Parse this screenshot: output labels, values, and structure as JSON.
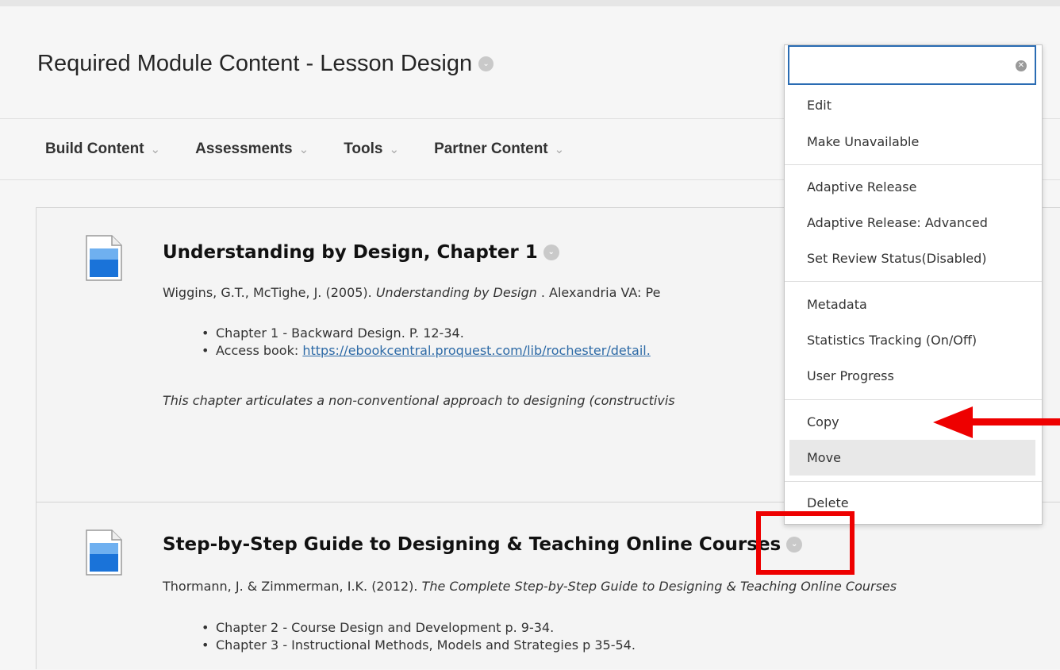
{
  "page": {
    "title": "Required Module Content - Lesson Design",
    "title_menu_icon": "chevron-down-icon"
  },
  "toolbar": {
    "items": [
      {
        "label": "Build Content"
      },
      {
        "label": "Assessments"
      },
      {
        "label": "Tools"
      },
      {
        "label": "Partner Content"
      }
    ]
  },
  "items": [
    {
      "icon": "document-icon",
      "title": "Understanding by Design, Chapter 1",
      "ref_authors": "Wiggins, G.T., McTighe, J. (2005). ",
      "ref_book": "Understanding by Design",
      "ref_rest": " . Alexandria VA: Pe",
      "bullets": [
        "Chapter 1 - Backward Design. P. 12-34."
      ],
      "access_label": "Access book: ",
      "access_link": "https://ebookcentral.proquest.com/lib/rochester/detail.",
      "description": "This chapter articulates a non-conventional approach to designing (constructivis"
    },
    {
      "icon": "document-icon",
      "title": "Step-by-Step Guide to Designing & Teaching Online Courses",
      "ref_authors": "Thormann, J. & Zimmerman, I.K. (2012).  ",
      "ref_book": "The Complete Step-by-Step Guide to Designing & Teaching Online Courses",
      "bullets": [
        "Chapter 2 - Course Design and Development p. 9-34.",
        "Chapter 3 - Instructional Methods, Models and Strategies p 35-54."
      ]
    }
  ],
  "context_menu": {
    "search_value": "",
    "group1": [
      "Edit",
      "Make Unavailable"
    ],
    "group2": [
      "Adaptive Release",
      "Adaptive Release: Advanced",
      "Set Review Status(Disabled)"
    ],
    "group3": [
      "Metadata",
      "Statistics Tracking (On/Off)",
      "User Progress"
    ],
    "group4": [
      "Copy",
      "Move"
    ],
    "group5": [
      "Delete"
    ],
    "highlighted": "Move"
  },
  "annotation": {
    "arrow_color": "#ee0000",
    "box_color": "#ee0000",
    "arrow_target": "Copy"
  },
  "colors": {
    "link": "#2d6aa6",
    "focus_border": "#2a6cb3",
    "icon_blue": "#1a73d9"
  }
}
